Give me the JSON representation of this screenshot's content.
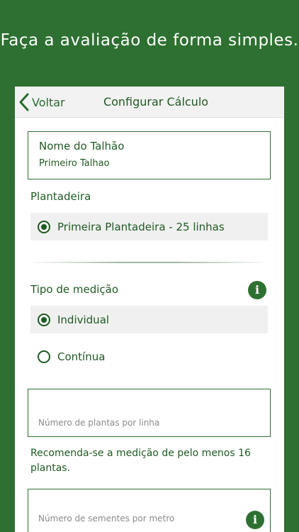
{
  "promo": {
    "headline": "Faça a avaliação de forma simples."
  },
  "navbar": {
    "back_label": "Voltar",
    "title": "Configurar Cálculo"
  },
  "field_name": {
    "label": "Nome do Talhão",
    "value": "Primeiro Talhao"
  },
  "planter": {
    "label": "Plantadeira",
    "options": [
      {
        "label": "Primeira Plantadeira - 25 linhas",
        "selected": true
      }
    ]
  },
  "measurement": {
    "label": "Tipo de medição",
    "options": [
      {
        "label": "Individual",
        "selected": true
      },
      {
        "label": "Contínua",
        "selected": false
      }
    ]
  },
  "plants_per_line": {
    "placeholder": "Número de plantas por linha"
  },
  "recommendation": "Recomenda-se a medição de pelo menos 16 plantas.",
  "seeds_per_meter": {
    "placeholder": "Número de sementes por metro"
  },
  "icons": {
    "back": "chevron-left-icon",
    "info": "info-icon",
    "radio_on": "radio-selected-icon",
    "radio_off": "radio-unselected-icon"
  },
  "colors": {
    "brand_green": "#2e7031",
    "text_green": "#1f5a22",
    "navbar_bg": "#f2f2f2",
    "option_bg": "#f0f0f0"
  }
}
